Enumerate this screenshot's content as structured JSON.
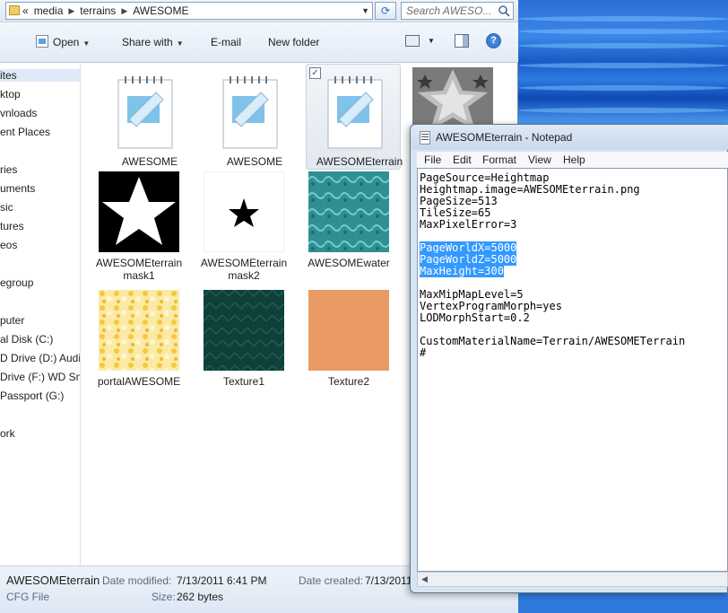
{
  "address": {
    "crumbs": [
      "«",
      "media",
      "terrains",
      "AWESOME"
    ],
    "search_placeholder": "Search AWESO..."
  },
  "toolbar": {
    "open": "Open",
    "share_with": "Share with",
    "email": "E-mail",
    "new_folder": "New folder",
    "help": "?"
  },
  "nav": {
    "items": [
      "ites",
      "ktop",
      "vnloads",
      "ent Places",
      "ries",
      "uments",
      "sic",
      "tures",
      "eos",
      "egroup",
      "puter",
      "al Disk (C:)",
      "D Drive (D:) Audio",
      "Drive (F:) WD Sm",
      "Passport (G:)",
      "ork"
    ]
  },
  "files": [
    {
      "label": "AWESOME"
    },
    {
      "label": "AWESOME"
    },
    {
      "label": "AWESOMEterrain"
    },
    {
      "label": ""
    },
    {
      "label": "AWESOMEterrain mask1"
    },
    {
      "label": "AWESOMEterrain mask2"
    },
    {
      "label": "AWESOMEwater"
    },
    {
      "label": "portalAWESOME"
    },
    {
      "label": "Texture1"
    },
    {
      "label": "Texture2"
    }
  ],
  "details": {
    "name": "AWESOMEterrain",
    "modified_label": "Date modified:",
    "modified_value": "7/13/2011 6:41 PM",
    "created_label": "Date created:",
    "created_value": "7/13/2011",
    "type": "CFG File",
    "size_label": "Size:",
    "size_value": "262 bytes"
  },
  "notepad": {
    "title": "AWESOMEterrain - Notepad",
    "menu": [
      "File",
      "Edit",
      "Format",
      "View",
      "Help"
    ],
    "lines": [
      {
        "text": "PageSource=Heightmap",
        "selected": false
      },
      {
        "text": "Heightmap.image=AWESOMEterrain.png",
        "selected": false
      },
      {
        "text": "PageSize=513",
        "selected": false
      },
      {
        "text": "TileSize=65",
        "selected": false
      },
      {
        "text": "MaxPixelError=3",
        "selected": false
      },
      {
        "text": "",
        "selected": false
      },
      {
        "text": "PageWorldX=5000",
        "selected": true
      },
      {
        "text": "PageWorldZ=5000",
        "selected": true
      },
      {
        "text": "MaxHeight=300",
        "selected": true
      },
      {
        "text": "",
        "selected": false
      },
      {
        "text": "MaxMipMapLevel=5",
        "selected": false
      },
      {
        "text": "VertexProgramMorph=yes",
        "selected": false
      },
      {
        "text": "LODMorphStart=0.2",
        "selected": false
      },
      {
        "text": "",
        "selected": false
      },
      {
        "text": "CustomMaterialName=Terrain/AWESOMETerrain",
        "selected": false
      },
      {
        "text": "#",
        "selected": false
      }
    ]
  },
  "colors": {
    "selection": "#3399ff",
    "window_frame": "#d7e4f2"
  }
}
